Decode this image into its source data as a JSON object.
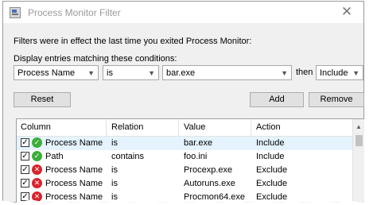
{
  "window": {
    "title": "Process Monitor Filter",
    "close_glyph": "✕",
    "icon": "procmon-app-icon"
  },
  "info_text": "Filters were in effect the last time you exited Process Monitor:",
  "condition_label": "Display entries matching these conditions:",
  "filter": {
    "column": "Process Name",
    "relation": "is",
    "value": "bar.exe",
    "then_label": "then",
    "action": "Include"
  },
  "buttons": {
    "reset": "Reset",
    "add": "Add",
    "remove": "Remove"
  },
  "list": {
    "headers": {
      "column": "Column",
      "relation": "Relation",
      "value": "Value",
      "action": "Action"
    },
    "rows": [
      {
        "checked": true,
        "type": "include",
        "column": "Process Name",
        "relation": "is",
        "value": "bar.exe",
        "action": "Include"
      },
      {
        "checked": true,
        "type": "include",
        "column": "Path",
        "relation": "contains",
        "value": "foo.ini",
        "action": "Include"
      },
      {
        "checked": true,
        "type": "exclude",
        "column": "Process Name",
        "relation": "is",
        "value": "Procexp.exe",
        "action": "Exclude"
      },
      {
        "checked": true,
        "type": "exclude",
        "column": "Process Name",
        "relation": "is",
        "value": "Autoruns.exe",
        "action": "Exclude"
      },
      {
        "checked": true,
        "type": "exclude",
        "column": "Process Name",
        "relation": "is",
        "value": "Procmon64.exe",
        "action": "Exclude"
      }
    ],
    "check_glyph": "✓",
    "include_glyph": "✓",
    "exclude_glyph": "✕"
  },
  "colors": {
    "include": "#3cae3a",
    "exclude": "#d9232b",
    "selected_row": "#e5f3ff"
  }
}
